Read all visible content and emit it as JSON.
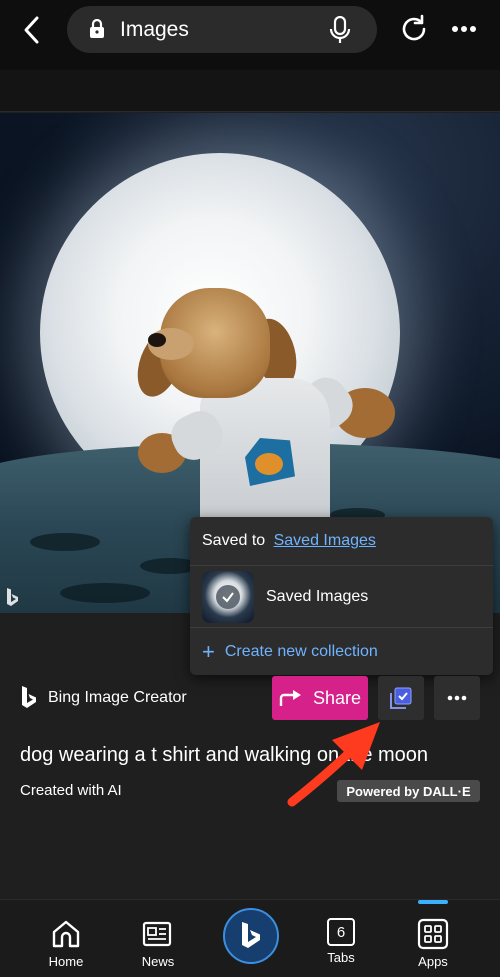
{
  "browser": {
    "url_title": "Images"
  },
  "image": {
    "watermark": "b"
  },
  "popup": {
    "saved_to_prefix": "Saved to",
    "saved_to_link": "Saved Images",
    "collection_name": "Saved Images",
    "create_label": "Create new collection"
  },
  "creator": {
    "label": "Bing Image Creator"
  },
  "actions": {
    "share_label": "Share"
  },
  "prompt": "dog wearing a t shirt and walking on the moon",
  "created_label": "Created with AI",
  "dalle_badge": "Powered by DALL·E",
  "bottom_nav": {
    "home": "Home",
    "news": "News",
    "tabs": "Tabs",
    "tabs_count": "6",
    "apps": "Apps"
  },
  "colors": {
    "share_bg": "#d6218b",
    "link": "#6fb3ff",
    "annotation_arrow": "#ff3b1f",
    "accent": "#3ab0ff"
  },
  "icons": [
    "back-arrow-icon",
    "lock-icon",
    "mic-icon",
    "reload-icon",
    "more-icon",
    "share-icon",
    "save-collection-icon",
    "plus-icon",
    "home-icon",
    "news-icon",
    "bing-icon",
    "tabs-icon",
    "apps-icon"
  ]
}
